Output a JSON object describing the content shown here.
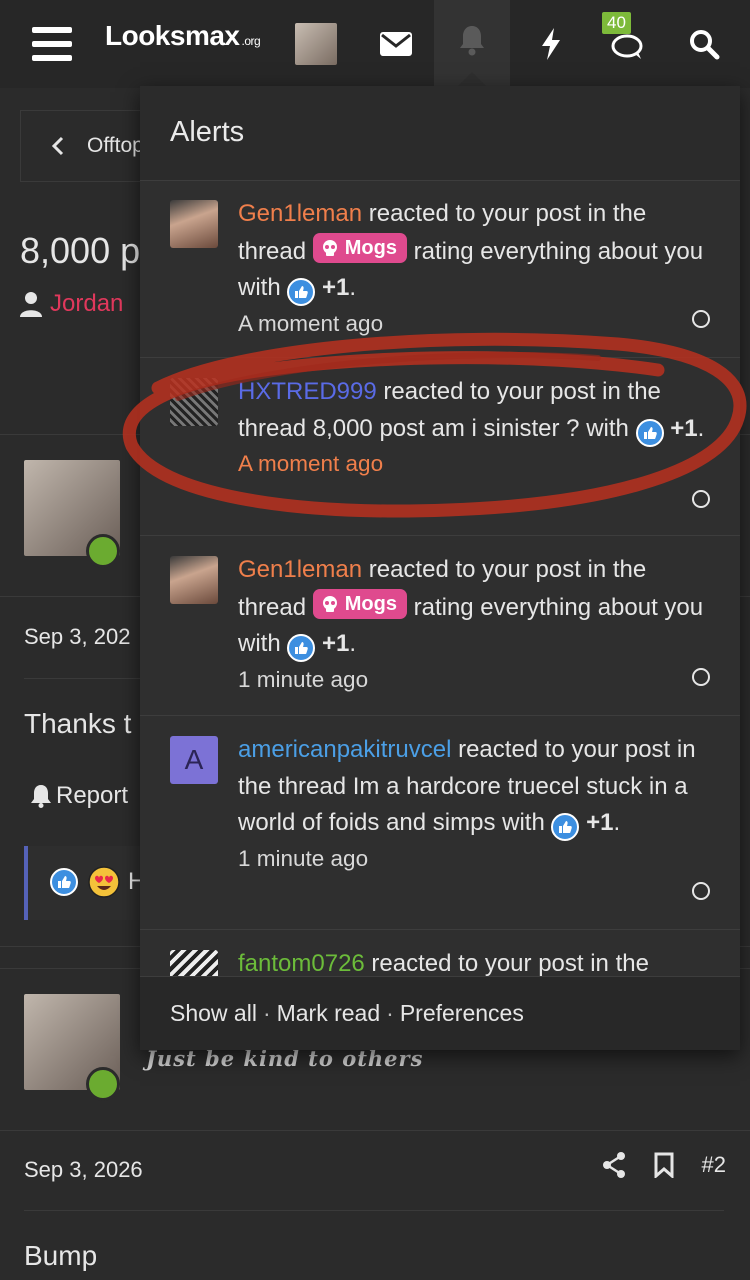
{
  "header": {
    "logo_text": "Looksmax",
    "logo_suffix": ".org",
    "chat_badge": "40"
  },
  "background_page": {
    "breadcrumb": "Offtop",
    "thread_title": "8,000 p",
    "author": "Jordan",
    "post1": {
      "date": "Sep 3, 202",
      "text": "Thanks t",
      "report_label": "Report",
      "reaction_letter": "H"
    },
    "post2": {
      "signature": "Just be kind to others",
      "date": "Sep 3, 2026",
      "post_number": "#2",
      "text": "Bump"
    }
  },
  "alerts_popup": {
    "title": "Alerts",
    "items": [
      {
        "user": "Gen1leman",
        "user_color": "#f07f4b",
        "pre": " reacted to your post in the thread ",
        "tag": "Mogs",
        "post": " rating everything about you with ",
        "reaction": "+1",
        "time": "A moment ago"
      },
      {
        "user": "HXTRED999",
        "user_color": "#5a6be6",
        "pre": " reacted to your post in the thread 8,000 post am i sinister ? with ",
        "reaction": "+1",
        "time": "A moment ago"
      },
      {
        "user": "Gen1leman",
        "user_color": "#f07f4b",
        "pre": " reacted to your post in the thread ",
        "tag": "Mogs",
        "post": " rating everything about you with ",
        "reaction": "+1",
        "time": "1 minute ago"
      },
      {
        "user": "americanpakitruvcel",
        "user_color": "#4b9fe6",
        "avatar_letter": "A",
        "pre": " reacted to your post in the thread Im a hardcore truecel stuck in a world of foids and simps with ",
        "reaction": "+1",
        "time": "1 minute ago"
      },
      {
        "user": "fantom0726",
        "user_color": "#6cbc3a",
        "pre": " reacted to your post in the"
      }
    ],
    "footer": {
      "show_all": "Show all",
      "mark_read": "Mark read",
      "preferences": "Preferences",
      "separator": "·"
    }
  },
  "colors": {
    "accent_pink": "#df4a8e",
    "online_green": "#6bab30",
    "like_blue": "#3d8fe0",
    "annotation_red": "#b8301e"
  }
}
